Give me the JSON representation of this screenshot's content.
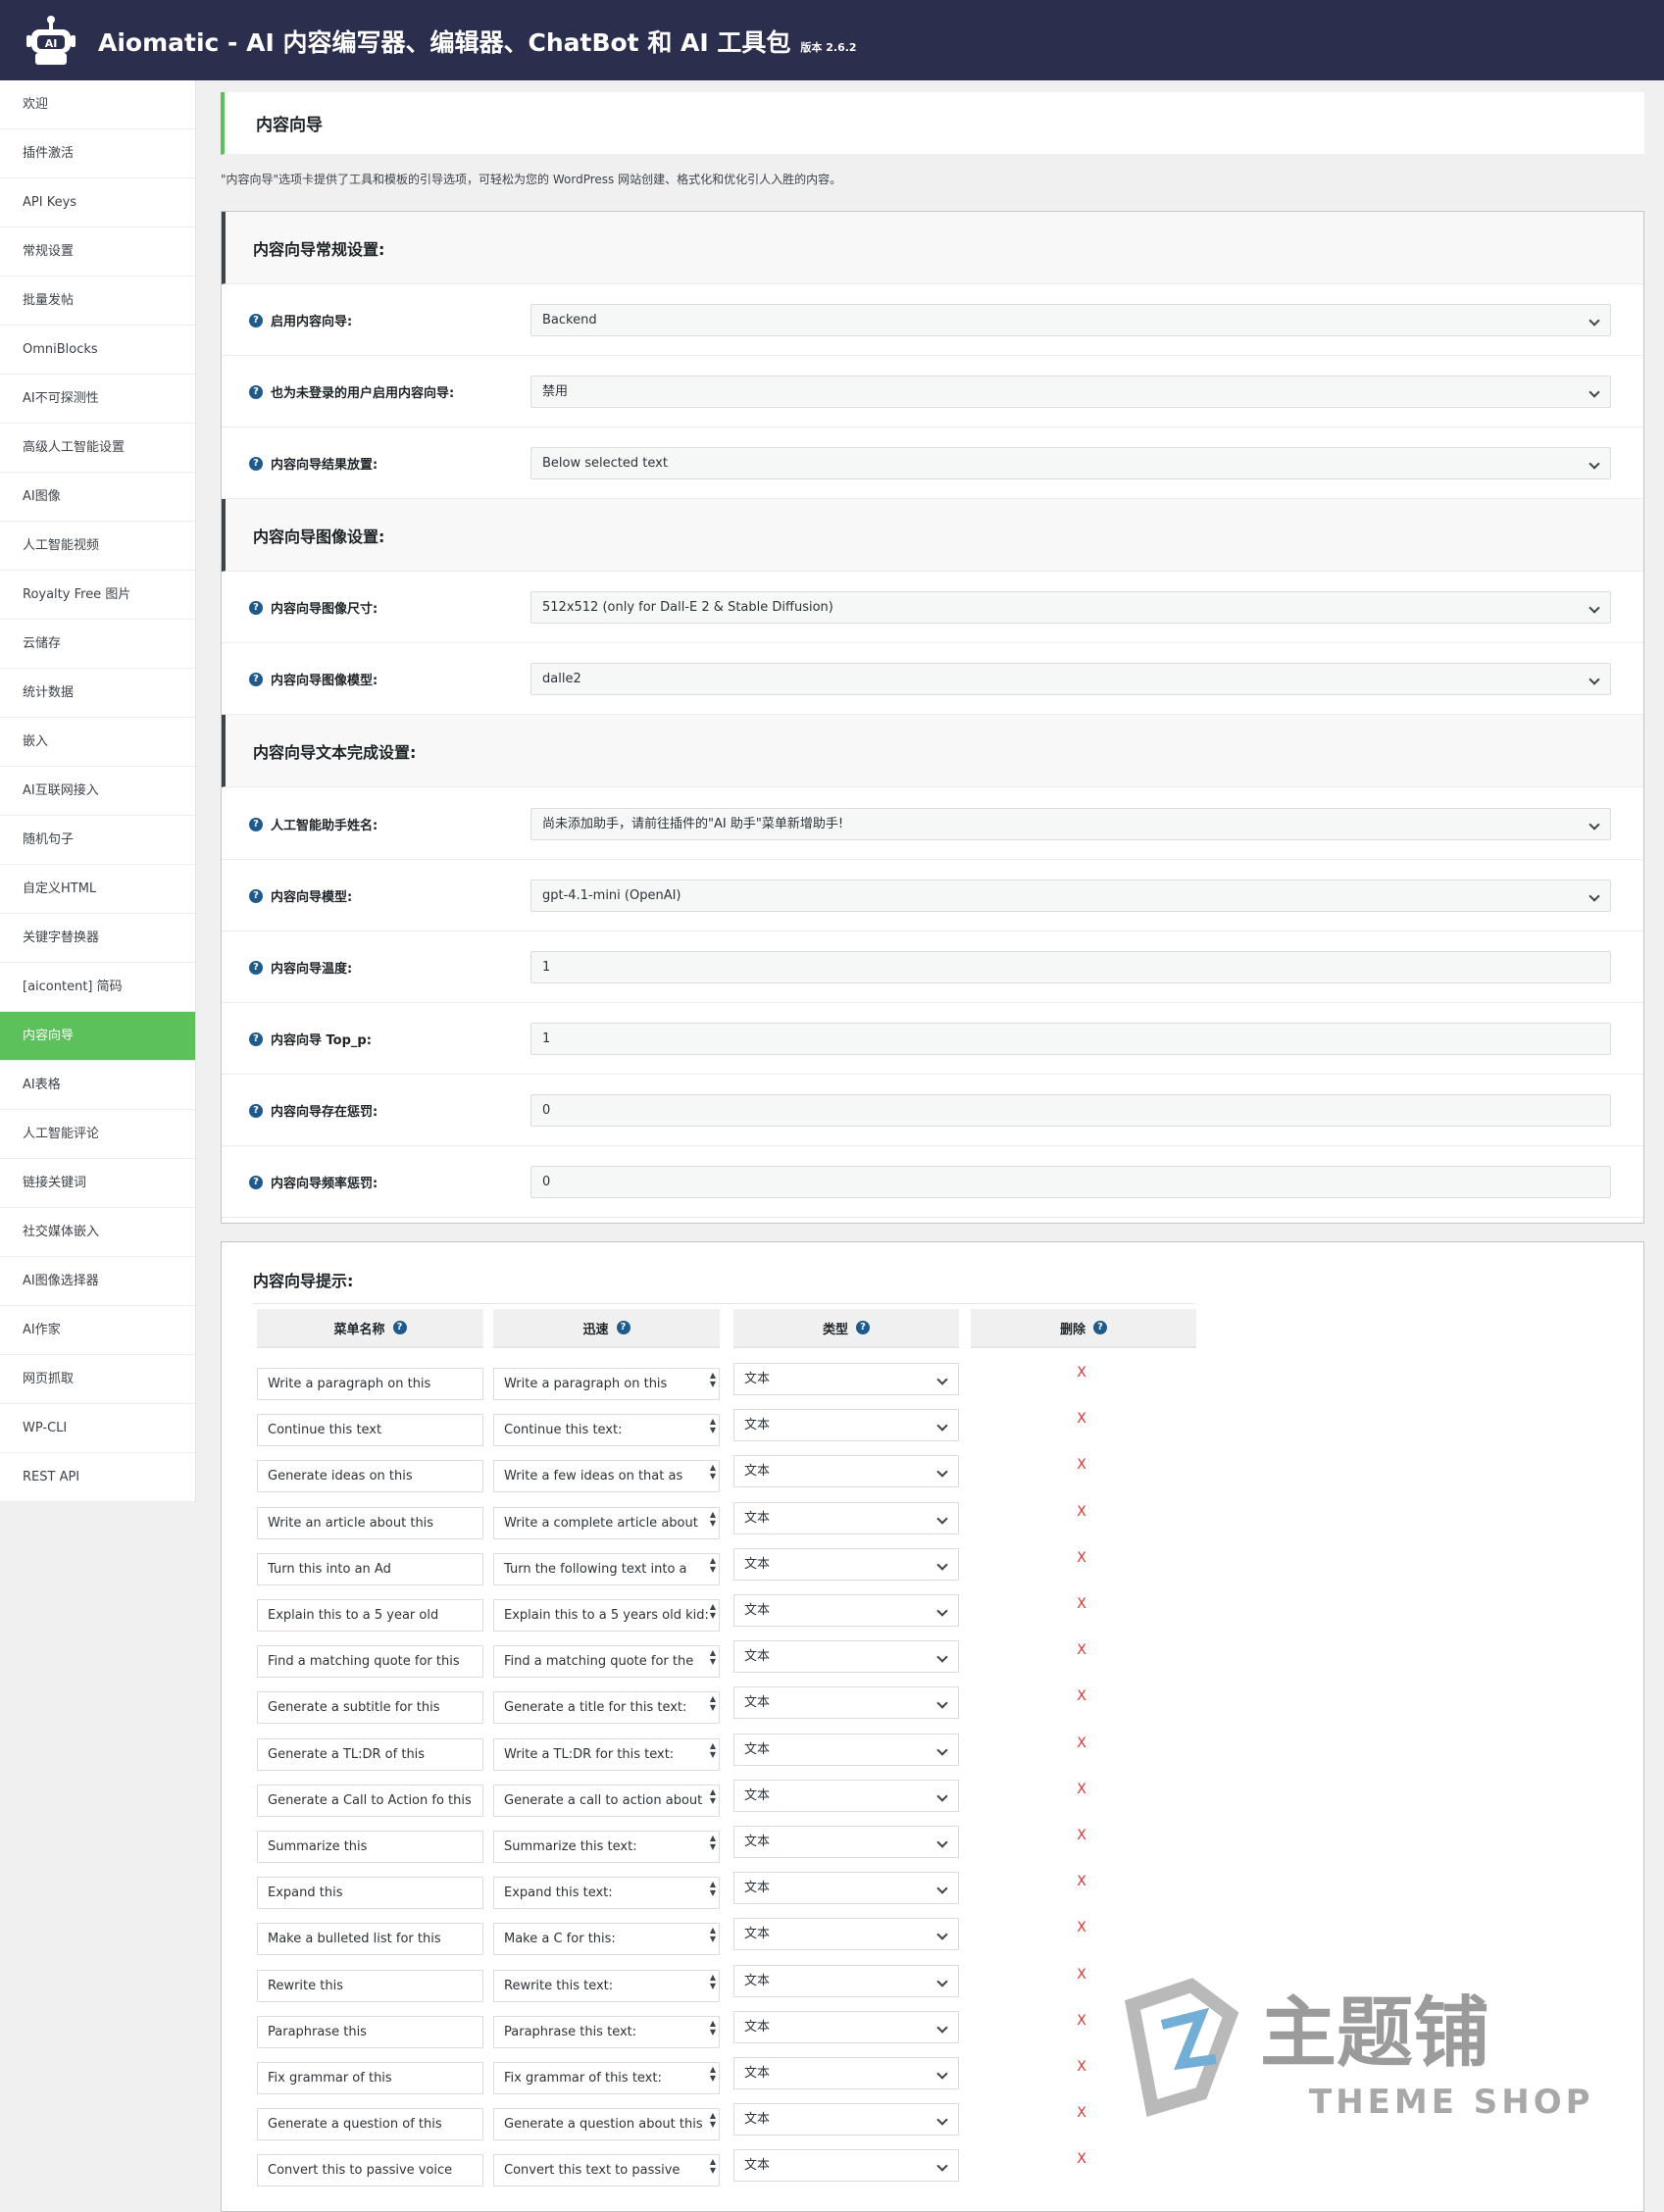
{
  "header": {
    "title": "Aiomatic - AI 内容编写器、编辑器、ChatBot 和 AI 工具包",
    "version": "版本 2.6.2",
    "logo_text": "AI",
    "colors": {
      "bg": "#2b2f4d",
      "accent": "#5cc05b"
    }
  },
  "sidebar": {
    "items": [
      {
        "label": "欢迎"
      },
      {
        "label": "插件激活"
      },
      {
        "label": "API Keys"
      },
      {
        "label": "常规设置"
      },
      {
        "label": "批量发帖"
      },
      {
        "label": "OmniBlocks"
      },
      {
        "label": "AI不可探测性"
      },
      {
        "label": "高级人工智能设置"
      },
      {
        "label": "AI图像"
      },
      {
        "label": "人工智能视频"
      },
      {
        "label": "Royalty Free 图片"
      },
      {
        "label": "云储存"
      },
      {
        "label": "统计数据"
      },
      {
        "label": "嵌入"
      },
      {
        "label": "AI互联网接入"
      },
      {
        "label": "随机句子"
      },
      {
        "label": "自定义HTML"
      },
      {
        "label": "关键字替换器"
      },
      {
        "label": "[aicontent] 简码"
      },
      {
        "label": "内容向导",
        "active": true
      },
      {
        "label": "AI表格"
      },
      {
        "label": "人工智能评论"
      },
      {
        "label": "链接关键词"
      },
      {
        "label": "社交媒体嵌入"
      },
      {
        "label": "AI图像选择器"
      },
      {
        "label": "AI作家"
      },
      {
        "label": "网页抓取"
      },
      {
        "label": "WP-CLI"
      },
      {
        "label": "REST API"
      }
    ]
  },
  "page": {
    "title": "内容向导",
    "description": "\"内容向导\"选项卡提供了工具和模板的引导选项，可轻松为您的 WordPress 网站创建、格式化和优化引人入胜的内容。"
  },
  "settings": {
    "sections": [
      {
        "title": "内容向导常规设置:"
      },
      {
        "title": "内容向导图像设置:"
      },
      {
        "title": "内容向导文本完成设置:"
      }
    ],
    "rows": [
      {
        "label": "启用内容向导:",
        "value": "Backend",
        "kind": "select"
      },
      {
        "label": "也为未登录的用户启用内容向导:",
        "value": "禁用",
        "kind": "select"
      },
      {
        "label": "内容向导结果放置:",
        "value": "Below selected text",
        "kind": "select"
      },
      {
        "label": "内容向导图像尺寸:",
        "value": "512x512 (only for Dall-E 2 & Stable Diffusion)",
        "kind": "select"
      },
      {
        "label": "内容向导图像模型:",
        "value": "dalle2",
        "kind": "select"
      },
      {
        "label": "人工智能助手姓名:",
        "value": "尚未添加助手，请前往插件的\"AI 助手\"菜单新增助手!",
        "kind": "select"
      },
      {
        "label": "内容向导模型:",
        "value": "gpt-4.1-mini (OpenAI)",
        "kind": "select"
      },
      {
        "label": "内容向导温度:",
        "value": "1",
        "kind": "input"
      },
      {
        "label": "内容向导 Top_p:",
        "value": "1",
        "kind": "input"
      },
      {
        "label": "内容向导存在惩罚:",
        "value": "0",
        "kind": "input"
      },
      {
        "label": "内容向导频率惩罚:",
        "value": "0",
        "kind": "input"
      }
    ]
  },
  "prompts": {
    "title": "内容向导提示:",
    "headers": {
      "name": "菜单名称",
      "prompt": "迅速",
      "type": "类型",
      "delete": "删除"
    },
    "help_glyph": "?",
    "delete_glyph": "X",
    "rows": [
      {
        "name": "Write a paragraph on this",
        "prompt": "Write a paragraph on this",
        "type": "文本"
      },
      {
        "name": "Continue this text",
        "prompt": "Continue this text:",
        "type": "文本"
      },
      {
        "name": "Generate ideas on this",
        "prompt": "Write a few ideas on that as",
        "type": "文本"
      },
      {
        "name": "Write an article about this",
        "prompt": "Write a complete article about",
        "type": "文本"
      },
      {
        "name": "Turn this into an Ad",
        "prompt": "Turn the following text into a",
        "type": "文本"
      },
      {
        "name": "Explain this to a 5 year old",
        "prompt": "Explain this to a 5 years old kid:",
        "type": "文本"
      },
      {
        "name": "Find a matching quote for this",
        "prompt": "Find a matching quote for the",
        "type": "文本"
      },
      {
        "name": "Generate a subtitle for this",
        "prompt": "Generate a title for this text:",
        "type": "文本"
      },
      {
        "name": "Generate a TL:DR of this",
        "prompt": "Write a TL:DR for this text:",
        "type": "文本"
      },
      {
        "name": "Generate a Call to Action fo this",
        "prompt": "Generate a call to action about",
        "type": "文本"
      },
      {
        "name": "Summarize this",
        "prompt": "Summarize this text:",
        "type": "文本"
      },
      {
        "name": "Expand this",
        "prompt": "Expand this text:",
        "type": "文本"
      },
      {
        "name": "Make a bulleted list for this",
        "prompt": "Make a C for this:",
        "type": "文本"
      },
      {
        "name": "Rewrite this",
        "prompt": "Rewrite this text:",
        "type": "文本"
      },
      {
        "name": "Paraphrase this",
        "prompt": "Paraphrase this text:",
        "type": "文本"
      },
      {
        "name": "Fix grammar of this",
        "prompt": "Fix grammar of this text:",
        "type": "文本"
      },
      {
        "name": "Generate a question of this",
        "prompt": "Generate a question about this",
        "type": "文本"
      },
      {
        "name": "Convert this to passive voice",
        "prompt": "Convert this text to passive",
        "type": "文本"
      }
    ]
  },
  "watermark": {
    "text_cn": "主题铺",
    "text_en": "THEME SHOP"
  }
}
